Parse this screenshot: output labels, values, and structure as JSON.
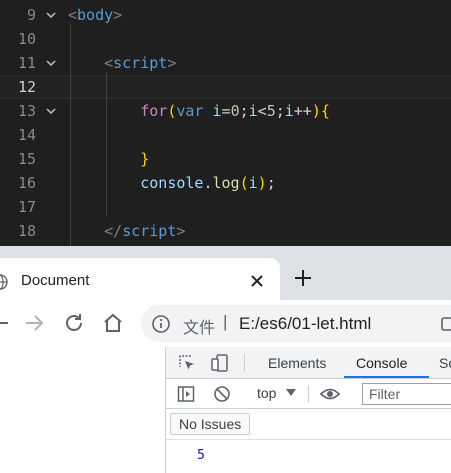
{
  "editor": {
    "lines": [
      {
        "num": "9",
        "fold": true,
        "active": false,
        "tokens": [
          [
            "t-punc",
            "<"
          ],
          [
            "t-tag",
            "body"
          ],
          [
            "t-punc",
            ">"
          ]
        ]
      },
      {
        "num": "10",
        "fold": false,
        "active": false,
        "tokens": []
      },
      {
        "num": "11",
        "fold": true,
        "active": false,
        "tokens": [
          [
            "t-plain",
            "    "
          ],
          [
            "t-punc",
            "<"
          ],
          [
            "t-tag",
            "script"
          ],
          [
            "t-punc",
            ">"
          ]
        ]
      },
      {
        "num": "12",
        "fold": false,
        "active": true,
        "tokens": []
      },
      {
        "num": "13",
        "fold": true,
        "active": false,
        "tokens": [
          [
            "t-plain",
            "        "
          ],
          [
            "t-kw",
            "for"
          ],
          [
            "t-br1",
            "("
          ],
          [
            "t-decl",
            "var"
          ],
          [
            "t-plain",
            " "
          ],
          [
            "t-var",
            "i"
          ],
          [
            "t-plain",
            "="
          ],
          [
            "t-num",
            "0"
          ],
          [
            "t-plain",
            ";"
          ],
          [
            "t-var",
            "i"
          ],
          [
            "t-plain",
            "<"
          ],
          [
            "t-num",
            "5"
          ],
          [
            "t-plain",
            ";"
          ],
          [
            "t-var",
            "i"
          ],
          [
            "t-plain",
            "++"
          ],
          [
            "t-br1",
            ")"
          ],
          [
            "t-br1",
            "{"
          ]
        ]
      },
      {
        "num": "14",
        "fold": false,
        "active": false,
        "tokens": []
      },
      {
        "num": "15",
        "fold": false,
        "active": false,
        "tokens": [
          [
            "t-plain",
            "        "
          ],
          [
            "t-br1",
            "}"
          ]
        ]
      },
      {
        "num": "16",
        "fold": false,
        "active": false,
        "tokens": [
          [
            "t-plain",
            "        "
          ],
          [
            "t-var",
            "console"
          ],
          [
            "t-plain",
            "."
          ],
          [
            "t-fn",
            "log"
          ],
          [
            "t-br1",
            "("
          ],
          [
            "t-var",
            "i"
          ],
          [
            "t-br1",
            ")"
          ],
          [
            "t-plain",
            ";"
          ]
        ]
      },
      {
        "num": "17",
        "fold": false,
        "active": false,
        "tokens": []
      },
      {
        "num": "18",
        "fold": false,
        "active": false,
        "tokens": [
          [
            "t-plain",
            "    "
          ],
          [
            "t-punc",
            "</"
          ],
          [
            "t-tag",
            "script"
          ],
          [
            "t-punc",
            ">"
          ]
        ]
      }
    ]
  },
  "browser": {
    "tab_title": "Document",
    "omnibox": {
      "chip": "文件",
      "separator": "|",
      "url": "E:/es6/01-let.html"
    }
  },
  "devtools": {
    "tabs": [
      "Elements",
      "Console",
      "So"
    ],
    "active_tab": "Console",
    "context": "top",
    "filter_placeholder": "Filter",
    "issues_label": "No Issues",
    "console_output": [
      "5"
    ],
    "accent_color": "#1a73e8"
  }
}
